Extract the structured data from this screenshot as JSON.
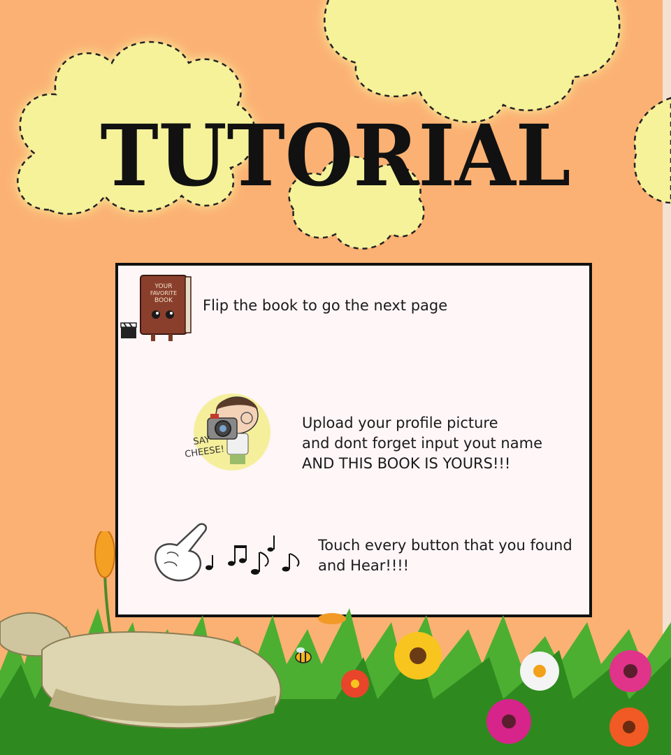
{
  "title": "TUTORIAL",
  "instructions": [
    {
      "icon": "book-character-icon",
      "icon_text": [
        "YOUR",
        "FAVORITE",
        "BOOK"
      ],
      "lines": [
        "Flip the book to go the next page"
      ]
    },
    {
      "icon": "camera-boy-icon",
      "icon_text": [
        "SAY",
        "CHEESE!"
      ],
      "lines": [
        "Upload your profile picture",
        "and dont forget input yout name",
        "AND THIS BOOK IS YOURS!!!"
      ]
    },
    {
      "icon": "pointing-hand-music-icon",
      "lines": [
        "Touch every button that you found",
        "and Hear!!!!"
      ]
    }
  ],
  "colors": {
    "background": "#fbb173",
    "cloud": "#f5f29a",
    "panel": "#fff6f8",
    "panel_border": "#111111",
    "grass": "#4caf32"
  }
}
